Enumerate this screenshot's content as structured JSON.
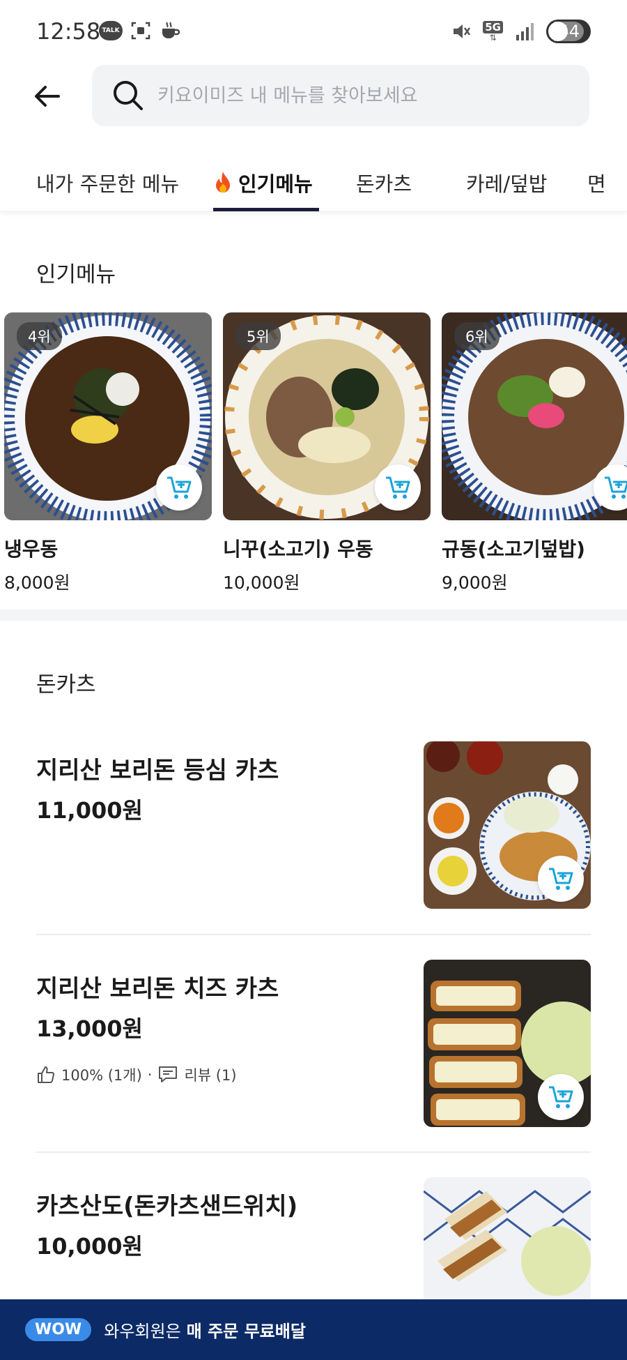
{
  "status_bar": {
    "time": "12:58",
    "talk_label": "TALK",
    "network": "5G",
    "battery": "44"
  },
  "header": {
    "search_placeholder": "키요이미즈 내 메뉴를 찾아보세요"
  },
  "tabs": [
    {
      "label": "내가 주문한 메뉴",
      "active": false
    },
    {
      "label": "인기메뉴",
      "active": true
    },
    {
      "label": "돈카츠",
      "active": false
    },
    {
      "label": "카레/덮밥",
      "active": false
    },
    {
      "label": "면",
      "active": false
    }
  ],
  "popular": {
    "title": "인기메뉴",
    "items": [
      {
        "rank": "4위",
        "name": "냉우동",
        "price": "8,000원"
      },
      {
        "rank": "5위",
        "name": "니꾸(소고기) 우동",
        "price": "10,000원"
      },
      {
        "rank": "6위",
        "name": "규동(소고기덮밥)",
        "price": "9,000원"
      }
    ]
  },
  "tonkatsu": {
    "title": "돈카츠",
    "items": [
      {
        "name": "지리산 보리돈 등심 카츠",
        "price": "11,000원"
      },
      {
        "name": "지리산 보리돈 치즈 카츠",
        "price": "13,000원",
        "like_text": "100% (1개)",
        "separator": "·",
        "review_text": "리뷰 (1)"
      },
      {
        "name": "카츠산도(돈카츠샌드위치)",
        "price": "10,000원"
      }
    ]
  },
  "wow_banner": {
    "badge": "WOW",
    "text": "와우회원은",
    "bold_text": "매 주문 무료배달"
  },
  "colors": {
    "accent": "#1e1c3a",
    "cart": "#1aa3d8",
    "wow_bar": "#0c2a66",
    "wow_badge": "#3a8be8"
  }
}
